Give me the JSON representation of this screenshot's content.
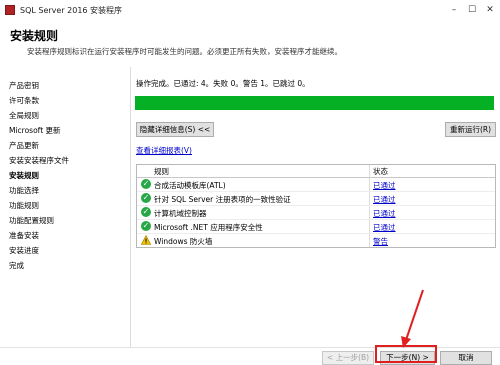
{
  "window": {
    "title": "SQL Server 2016 安装程序"
  },
  "header": {
    "title": "安装规则",
    "description": "安装程序规则标识在运行安装程序时可能发生的问题。必须更正所有失败，安装程序才能继续。"
  },
  "sidebar": {
    "items": [
      {
        "label": "产品密钥"
      },
      {
        "label": "许可条款"
      },
      {
        "label": "全局规则"
      },
      {
        "label": "Microsoft 更新"
      },
      {
        "label": "产品更新"
      },
      {
        "label": "安装安装程序文件"
      },
      {
        "label": "安装规则"
      },
      {
        "label": "功能选择"
      },
      {
        "label": "功能规则"
      },
      {
        "label": "功能配置规则"
      },
      {
        "label": "准备安装"
      },
      {
        "label": "安装进度"
      },
      {
        "label": "完成"
      }
    ],
    "active_index": 6
  },
  "main": {
    "status_text": "操作完成。已通过: 4。失败 0。警告 1。已跳过 0。",
    "progress": 1.0,
    "progress_color": "#06b025",
    "hide_details_label": "隐藏详细信息(S) <<",
    "rerun_label": "重新运行(R)",
    "report_link": "查看详细报表(V)",
    "table": {
      "headers": [
        "规则",
        "状态"
      ],
      "rows": [
        {
          "icon": "check-icon",
          "rule": "合成活动模板库(ATL)",
          "status": "已通过"
        },
        {
          "icon": "check-icon",
          "rule": "针对 SQL Server 注册表项的一致性验证",
          "status": "已通过"
        },
        {
          "icon": "check-icon",
          "rule": "计算机域控制器",
          "status": "已通过"
        },
        {
          "icon": "check-icon",
          "rule": "Microsoft .NET 应用程序安全性",
          "status": "已通过"
        },
        {
          "icon": "warning-icon",
          "rule": "Windows 防火墙",
          "status": "警告"
        }
      ]
    }
  },
  "footer": {
    "back_label": "< 上一步(B)",
    "next_label": "下一步(N) >",
    "cancel_label": "取消"
  },
  "colors": {
    "highlight": "#e02020",
    "success": "#27a745",
    "warning": "#f2c200"
  }
}
